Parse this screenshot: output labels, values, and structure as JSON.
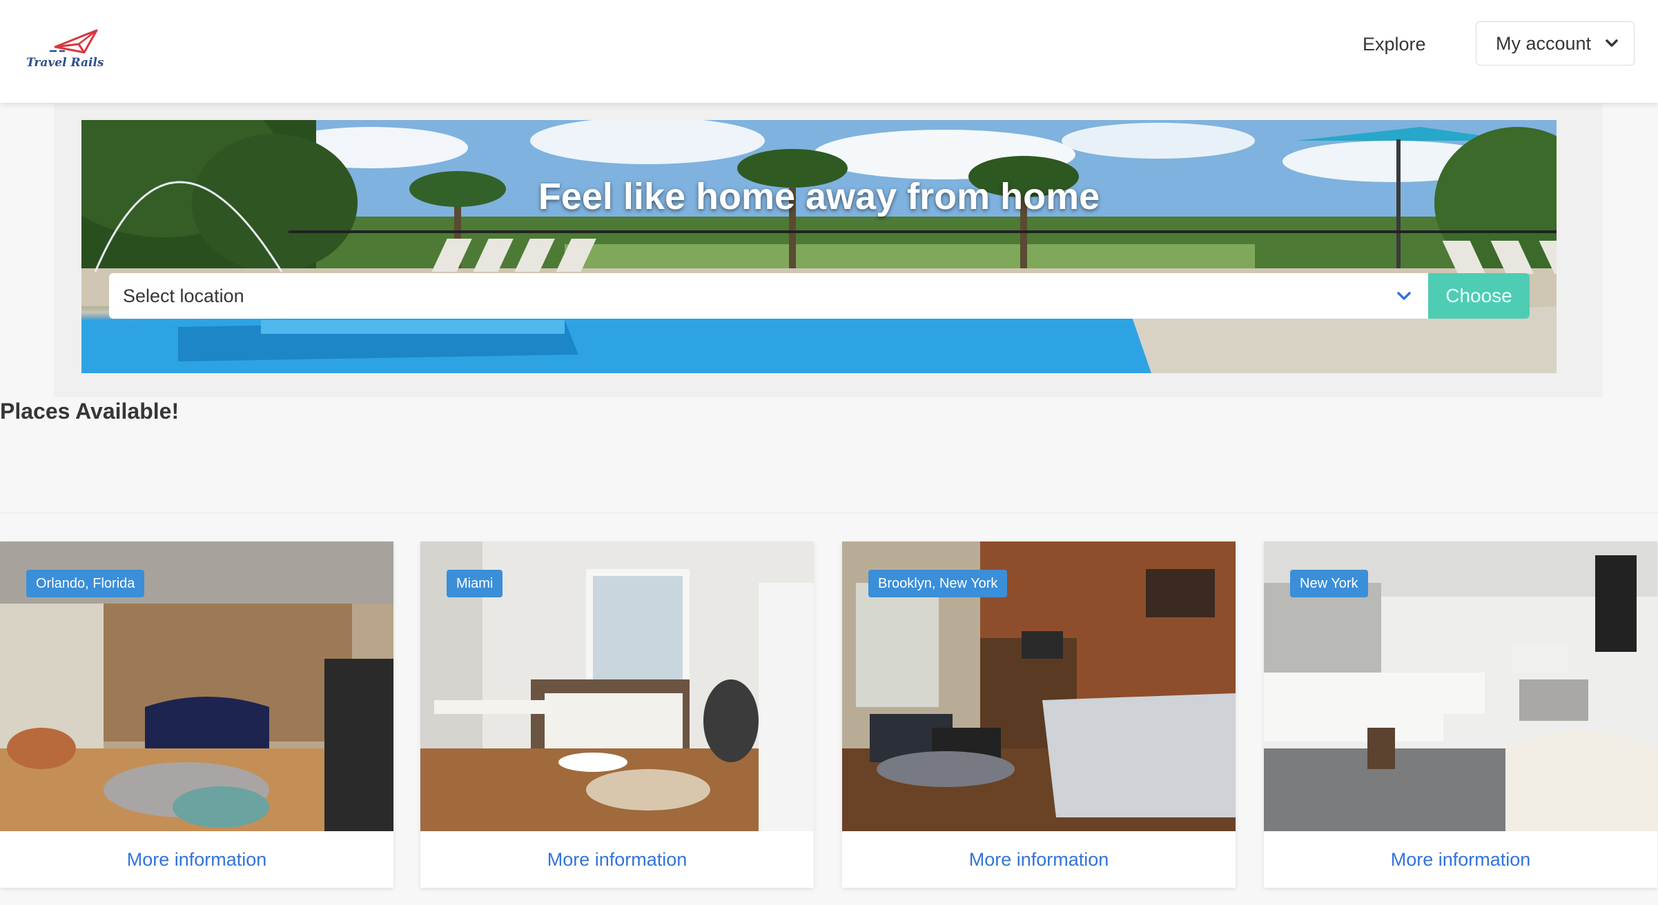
{
  "app": {
    "brand": "Travel Rails"
  },
  "nav": {
    "explore_label": "Explore",
    "account_label": "My account"
  },
  "hero": {
    "title": "Feel like home away from home",
    "select_placeholder": "Select location",
    "choose_label": "Choose"
  },
  "places": {
    "heading": "Places Available!",
    "cards": [
      {
        "location": "Orlando, Florida",
        "link_label": "More information"
      },
      {
        "location": "Miami",
        "link_label": "More information"
      },
      {
        "location": "Brooklyn, New York",
        "link_label": "More information"
      },
      {
        "location": "New York",
        "link_label": "More information"
      }
    ]
  },
  "colors": {
    "primary_link": "#3273dc",
    "accent_button": "#4ecdb4",
    "tag_bg": "#3b8ed8"
  }
}
